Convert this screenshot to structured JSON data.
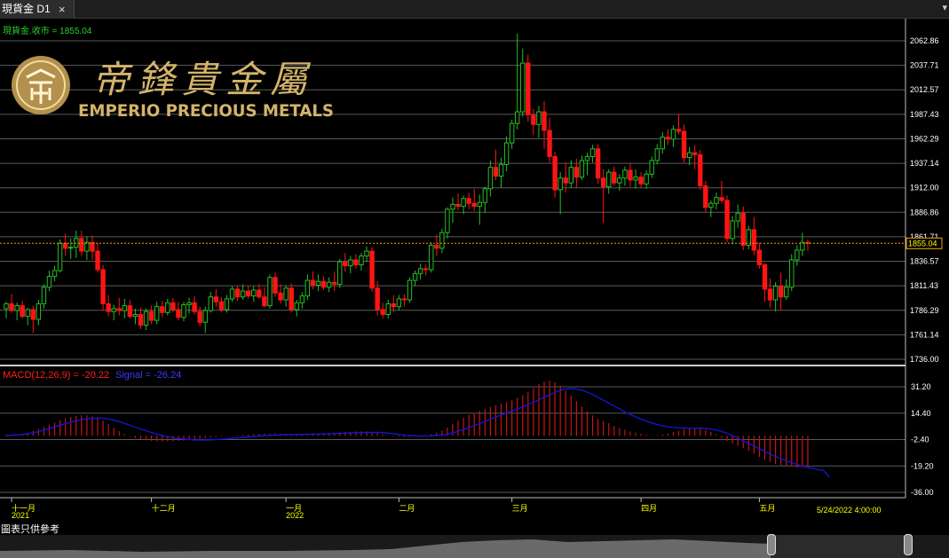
{
  "tab": {
    "title": "現貨金 D1",
    "close": "×",
    "menu": "▾"
  },
  "price_label": "現貨金.收市 = 1855.04",
  "brand": {
    "chinese": "帝鋒貴金屬",
    "english": "EMPERIO PRECIOUS METALS"
  },
  "macd_label": "MACD(12,26,9) = -20.22",
  "signal_label": "Signal = -26.24",
  "last_price_tag": "1855.04",
  "last_date_label": "5/24/2022 4:00:00",
  "footnote": "圖表只供參考",
  "colors": {
    "up": "#22c022",
    "down": "#ff1414",
    "macd": "#c81414",
    "signal": "#1414d2",
    "axis_text": "#ffff00",
    "grid": "#5a5a5a",
    "last_line": "#ffa000"
  },
  "chart_data": {
    "type": "candlestick",
    "price_axis": {
      "ticks": [
        2062.86,
        2037.71,
        2012.57,
        1987.43,
        1962.29,
        1937.14,
        1912.0,
        1886.86,
        1861.71,
        1836.57,
        1811.43,
        1786.29,
        1761.14,
        1736.0
      ],
      "range": [
        1736.0,
        2062.86
      ]
    },
    "macd_axis": {
      "ticks": [
        31.2,
        14.4,
        -2.4,
        -19.2,
        -36.0
      ],
      "range": [
        -36.0,
        31.2
      ]
    },
    "x_labels": [
      {
        "text": "十一月",
        "index": 1
      },
      {
        "text": "2021",
        "index": 1,
        "row": 2
      },
      {
        "text": "十二月",
        "index": 27
      },
      {
        "text": "一月",
        "index": 52
      },
      {
        "text": "2022",
        "index": 52,
        "row": 2
      },
      {
        "text": "二月",
        "index": 73
      },
      {
        "text": "三月",
        "index": 94
      },
      {
        "text": "四月",
        "index": 118
      },
      {
        "text": "五月",
        "index": 140
      }
    ],
    "candles": [
      [
        1788,
        1795,
        1778,
        1793
      ],
      [
        1793,
        1803,
        1784,
        1786
      ],
      [
        1786,
        1794,
        1776,
        1791
      ],
      [
        1791,
        1796,
        1778,
        1780
      ],
      [
        1780,
        1789,
        1771,
        1787
      ],
      [
        1787,
        1791,
        1763,
        1777
      ],
      [
        1777,
        1797,
        1771,
        1793
      ],
      [
        1793,
        1813,
        1788,
        1810
      ],
      [
        1810,
        1827,
        1806,
        1821
      ],
      [
        1821,
        1832,
        1816,
        1827
      ],
      [
        1827,
        1859,
        1825,
        1855
      ],
      [
        1855,
        1865,
        1842,
        1850
      ],
      [
        1850,
        1860,
        1839,
        1851
      ],
      [
        1851,
        1868,
        1840,
        1860
      ],
      [
        1860,
        1868,
        1842,
        1847
      ],
      [
        1847,
        1862,
        1838,
        1856
      ],
      [
        1856,
        1863,
        1838,
        1847
      ],
      [
        1847,
        1855,
        1825,
        1828
      ],
      [
        1828,
        1833,
        1786,
        1793
      ],
      [
        1793,
        1802,
        1780,
        1785
      ],
      [
        1785,
        1792,
        1776,
        1788
      ],
      [
        1788,
        1799,
        1781,
        1786
      ],
      [
        1786,
        1798,
        1778,
        1791
      ],
      [
        1791,
        1797,
        1778,
        1780
      ],
      [
        1780,
        1788,
        1772,
        1782
      ],
      [
        1782,
        1789,
        1767,
        1771
      ],
      [
        1771,
        1788,
        1766,
        1785
      ],
      [
        1785,
        1791,
        1772,
        1776
      ],
      [
        1776,
        1795,
        1772,
        1790
      ],
      [
        1790,
        1796,
        1779,
        1784
      ],
      [
        1784,
        1798,
        1781,
        1794
      ],
      [
        1794,
        1799,
        1784,
        1787
      ],
      [
        1787,
        1795,
        1776,
        1779
      ],
      [
        1779,
        1795,
        1775,
        1792
      ],
      [
        1792,
        1799,
        1783,
        1794
      ],
      [
        1794,
        1801,
        1782,
        1785
      ],
      [
        1785,
        1790,
        1770,
        1774
      ],
      [
        1774,
        1790,
        1763,
        1786
      ],
      [
        1786,
        1805,
        1784,
        1800
      ],
      [
        1800,
        1808,
        1790,
        1795
      ],
      [
        1795,
        1800,
        1784,
        1787
      ],
      [
        1787,
        1802,
        1784,
        1798
      ],
      [
        1798,
        1811,
        1795,
        1808
      ],
      [
        1808,
        1812,
        1796,
        1800
      ],
      [
        1800,
        1813,
        1797,
        1806
      ],
      [
        1806,
        1812,
        1798,
        1801
      ],
      [
        1801,
        1811,
        1795,
        1807
      ],
      [
        1807,
        1813,
        1798,
        1800
      ],
      [
        1800,
        1810,
        1789,
        1791
      ],
      [
        1791,
        1823,
        1788,
        1820
      ],
      [
        1820,
        1825,
        1800,
        1804
      ],
      [
        1804,
        1813,
        1793,
        1797
      ],
      [
        1797,
        1812,
        1790,
        1809
      ],
      [
        1809,
        1814,
        1784,
        1787
      ],
      [
        1787,
        1797,
        1780,
        1794
      ],
      [
        1794,
        1805,
        1788,
        1801
      ],
      [
        1801,
        1823,
        1797,
        1817
      ],
      [
        1817,
        1826,
        1808,
        1812
      ],
      [
        1812,
        1823,
        1806,
        1816
      ],
      [
        1816,
        1821,
        1807,
        1810
      ],
      [
        1810,
        1820,
        1805,
        1815
      ],
      [
        1815,
        1826,
        1806,
        1813
      ],
      [
        1813,
        1839,
        1809,
        1836
      ],
      [
        1836,
        1845,
        1826,
        1832
      ],
      [
        1832,
        1842,
        1824,
        1838
      ],
      [
        1838,
        1844,
        1829,
        1833
      ],
      [
        1833,
        1845,
        1827,
        1842
      ],
      [
        1842,
        1852,
        1836,
        1847
      ],
      [
        1847,
        1851,
        1805,
        1809
      ],
      [
        1809,
        1816,
        1781,
        1787
      ],
      [
        1787,
        1794,
        1778,
        1782
      ],
      [
        1782,
        1797,
        1778,
        1793
      ],
      [
        1793,
        1802,
        1784,
        1790
      ],
      [
        1790,
        1802,
        1786,
        1798
      ],
      [
        1798,
        1803,
        1790,
        1797
      ],
      [
        1797,
        1820,
        1794,
        1817
      ],
      [
        1817,
        1827,
        1811,
        1824
      ],
      [
        1824,
        1834,
        1818,
        1829
      ],
      [
        1829,
        1833,
        1822,
        1828
      ],
      [
        1828,
        1856,
        1825,
        1853
      ],
      [
        1853,
        1864,
        1842,
        1850
      ],
      [
        1850,
        1870,
        1845,
        1866
      ],
      [
        1866,
        1892,
        1860,
        1890
      ],
      [
        1890,
        1902,
        1876,
        1895
      ],
      [
        1895,
        1906,
        1889,
        1893
      ],
      [
        1893,
        1904,
        1885,
        1901
      ],
      [
        1901,
        1907,
        1890,
        1896
      ],
      [
        1896,
        1911,
        1888,
        1893
      ],
      [
        1893,
        1905,
        1874,
        1897
      ],
      [
        1897,
        1913,
        1886,
        1911
      ],
      [
        1911,
        1940,
        1903,
        1933
      ],
      [
        1933,
        1951,
        1920,
        1924
      ],
      [
        1924,
        1943,
        1912,
        1936
      ],
      [
        1936,
        1965,
        1929,
        1958
      ],
      [
        1958,
        1982,
        1952,
        1978
      ],
      [
        1978,
        2070,
        1972,
        1990
      ],
      [
        1990,
        2055,
        1985,
        2040
      ],
      [
        2040,
        2049,
        1980,
        1987
      ],
      [
        1987,
        1993,
        1966,
        1977
      ],
      [
        1977,
        1996,
        1963,
        1990
      ],
      [
        1990,
        2001,
        1952,
        1971
      ],
      [
        1971,
        1984,
        1938,
        1944
      ],
      [
        1944,
        1949,
        1902,
        1910
      ],
      [
        1910,
        1928,
        1885,
        1922
      ],
      [
        1922,
        1938,
        1907,
        1917
      ],
      [
        1917,
        1940,
        1912,
        1933
      ],
      [
        1933,
        1942,
        1912,
        1923
      ],
      [
        1923,
        1945,
        1920,
        1940
      ],
      [
        1940,
        1948,
        1925,
        1944
      ],
      [
        1944,
        1956,
        1938,
        1952
      ],
      [
        1952,
        1957,
        1916,
        1922
      ],
      [
        1922,
        1931,
        1876,
        1913
      ],
      [
        1913,
        1931,
        1906,
        1928
      ],
      [
        1928,
        1934,
        1914,
        1917
      ],
      [
        1917,
        1926,
        1909,
        1922
      ],
      [
        1922,
        1934,
        1914,
        1930
      ],
      [
        1930,
        1938,
        1913,
        1920
      ],
      [
        1920,
        1931,
        1911,
        1923
      ],
      [
        1923,
        1928,
        1912,
        1916
      ],
      [
        1916,
        1930,
        1911,
        1926
      ],
      [
        1926,
        1944,
        1922,
        1940
      ],
      [
        1940,
        1957,
        1936,
        1952
      ],
      [
        1952,
        1969,
        1947,
        1964
      ],
      [
        1964,
        1972,
        1956,
        1962
      ],
      [
        1962,
        1976,
        1954,
        1972
      ],
      [
        1972,
        1988,
        1967,
        1970
      ],
      [
        1970,
        1977,
        1938,
        1943
      ],
      [
        1943,
        1954,
        1935,
        1948
      ],
      [
        1948,
        1956,
        1931,
        1946
      ],
      [
        1946,
        1951,
        1910,
        1914
      ],
      [
        1914,
        1919,
        1887,
        1892
      ],
      [
        1892,
        1899,
        1882,
        1896
      ],
      [
        1896,
        1907,
        1890,
        1902
      ],
      [
        1902,
        1919,
        1896,
        1899
      ],
      [
        1899,
        1904,
        1856,
        1860
      ],
      [
        1860,
        1883,
        1854,
        1878
      ],
      [
        1878,
        1895,
        1871,
        1886
      ],
      [
        1886,
        1893,
        1848,
        1853
      ],
      [
        1853,
        1873,
        1849,
        1869
      ],
      [
        1869,
        1882,
        1843,
        1848
      ],
      [
        1848,
        1856,
        1829,
        1833
      ],
      [
        1833,
        1835,
        1795,
        1808
      ],
      [
        1808,
        1819,
        1789,
        1797
      ],
      [
        1797,
        1815,
        1785,
        1811
      ],
      [
        1811,
        1825,
        1786,
        1800
      ],
      [
        1800,
        1818,
        1797,
        1810
      ],
      [
        1810,
        1844,
        1806,
        1838
      ],
      [
        1838,
        1853,
        1832,
        1848
      ],
      [
        1848,
        1866,
        1842,
        1856
      ],
      [
        1856,
        1859,
        1847,
        1855
      ]
    ],
    "series": [
      {
        "name": "MACD(12,26,9)",
        "values": [
          0.8,
          0.6,
          0.9,
          1.3,
          1.9,
          3.0,
          4.4,
          5.7,
          7.1,
          8.4,
          9.9,
          11.1,
          12.1,
          12.6,
          13.0,
          13.0,
          12.4,
          11.2,
          9.7,
          7.4,
          5.0,
          2.9,
          1.0,
          -0.4,
          -1.4,
          -2.3,
          -2.8,
          -3.2,
          -3.5,
          -3.6,
          -3.5,
          -3.4,
          -3.2,
          -3.0,
          -2.6,
          -2.2,
          -1.8,
          -1.4,
          -1.0,
          -0.7,
          -0.4,
          -0.1,
          0.2,
          0.4,
          0.6,
          0.8,
          1.0,
          1.1,
          1.2,
          1.3,
          1.4,
          1.3,
          1.2,
          1.1,
          1.1,
          1.2,
          1.3,
          1.4,
          1.6,
          1.7,
          1.8,
          2.0,
          2.2,
          2.4,
          2.5,
          2.7,
          2.8,
          2.7,
          2.4,
          1.8,
          0.9,
          0.1,
          -0.4,
          -0.6,
          -0.8,
          -0.7,
          -0.6,
          -0.2,
          0.3,
          1.0,
          2.0,
          3.4,
          5.2,
          7.4,
          9.6,
          11.4,
          13.3,
          14.6,
          15.9,
          17.2,
          18.3,
          19.4,
          20.4,
          21.4,
          22.6,
          24.0,
          25.8,
          28.0,
          30.4,
          32.8,
          34.4,
          35.1,
          34.0,
          31.9,
          28.5,
          25.6,
          21.9,
          18.6,
          15.6,
          13.0,
          10.9,
          9.4,
          8.0,
          6.3,
          4.8,
          3.8,
          2.8,
          1.9,
          1.2,
          0.6,
          0.2,
          0.4,
          0.8,
          1.5,
          2.4,
          3.3,
          4.2,
          4.6,
          4.7,
          4.4,
          3.7,
          2.5,
          0.9,
          -1.3,
          -3.3,
          -4.9,
          -6.4,
          -7.9,
          -9.5,
          -11.4,
          -13.5,
          -15.3,
          -16.7,
          -18.0,
          -18.7,
          -19.2,
          -19.7,
          -20.1,
          -20.2,
          -20.22
        ]
      },
      {
        "name": "Signal",
        "values": [
          0.0,
          0.4,
          0.6,
          0.9,
          1.3,
          1.9,
          2.7,
          3.6,
          4.6,
          5.7,
          6.7,
          7.8,
          8.7,
          9.6,
          10.3,
          10.9,
          11.2,
          11.4,
          11.2,
          10.8,
          9.9,
          9.0,
          7.9,
          6.7,
          5.5,
          4.3,
          3.2,
          2.1,
          1.1,
          0.2,
          -0.6,
          -1.2,
          -1.7,
          -2.1,
          -2.4,
          -2.6,
          -2.7,
          -2.7,
          -2.6,
          -2.4,
          -2.2,
          -2.0,
          -1.6,
          -1.3,
          -1.0,
          -0.7,
          -0.4,
          -0.1,
          0.1,
          0.3,
          0.5,
          0.6,
          0.7,
          0.8,
          0.9,
          0.9,
          1.0,
          1.0,
          1.1,
          1.2,
          1.3,
          1.4,
          1.5,
          1.6,
          1.8,
          1.9,
          2.0,
          2.1,
          2.2,
          2.1,
          2.0,
          1.7,
          1.3,
          0.9,
          0.5,
          0.2,
          0.0,
          -0.1,
          -0.1,
          0.0,
          0.2,
          0.6,
          1.1,
          1.9,
          2.8,
          3.9,
          5.2,
          6.5,
          7.8,
          9.2,
          10.6,
          11.9,
          13.2,
          14.5,
          15.8,
          17.1,
          18.4,
          19.8,
          21.3,
          22.8,
          24.5,
          26.1,
          27.6,
          28.9,
          29.7,
          30.0,
          29.8,
          29.0,
          27.8,
          26.3,
          24.6,
          22.7,
          20.8,
          18.9,
          17.1,
          15.3,
          13.6,
          12.0,
          10.6,
          9.3,
          8.2,
          7.1,
          6.3,
          5.7,
          5.3,
          5.1,
          5.0,
          4.9,
          4.9,
          4.9,
          4.7,
          4.3,
          3.7,
          2.8,
          1.6,
          0.1,
          -1.5,
          -3.2,
          -4.9,
          -6.6,
          -8.3,
          -10.0,
          -11.6,
          -13.2,
          -14.6,
          -15.9,
          -17.1,
          -18.2,
          -19.2,
          -20.1,
          -20.8,
          -21.5,
          -22.2,
          -26.24
        ]
      }
    ]
  }
}
